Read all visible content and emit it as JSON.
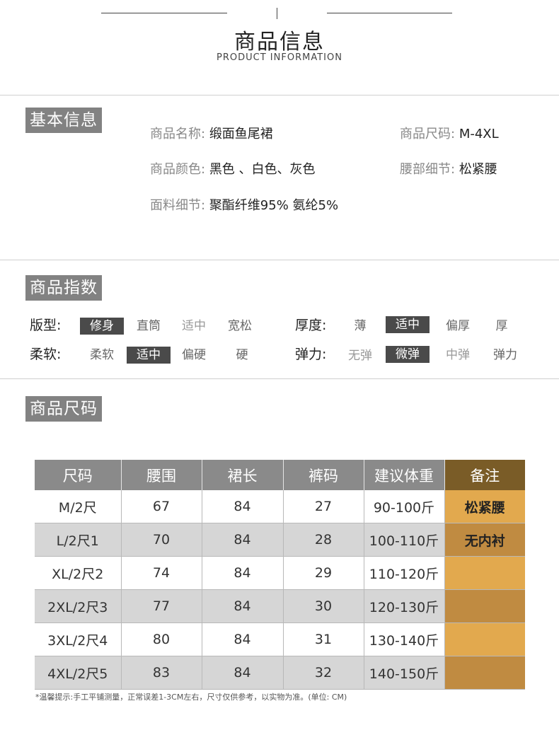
{
  "header": {
    "title_cn": "商品信息",
    "title_en": "PRODUCT INFORMATION"
  },
  "basic": {
    "label": "基本信息",
    "items": [
      {
        "key": "商品名称:",
        "value": "缎面鱼尾裙"
      },
      {
        "key": "商品尺码:",
        "value": "M-4XL"
      },
      {
        "key": "商品颜色:",
        "value": "黑色 、白色、灰色"
      },
      {
        "key": "腰部细节:",
        "value": "松紧腰"
      },
      {
        "key": "面料细节:",
        "value": "聚酯纤维95% 氨纶5%"
      }
    ]
  },
  "index": {
    "label": "商品指数",
    "rows": [
      {
        "key": "版型:",
        "options": [
          "修身",
          "直筒",
          "适中",
          "宽松"
        ],
        "selected": "修身"
      },
      {
        "key": "厚度:",
        "options": [
          "薄",
          "适中",
          "偏厚",
          "厚"
        ],
        "selected": "适中"
      },
      {
        "key": "柔软:",
        "options": [
          "柔软",
          "适中",
          "偏硬",
          "硬"
        ],
        "selected": "适中"
      },
      {
        "key": "弹力:",
        "options": [
          "无弹",
          "微弹",
          "中弹",
          "弹力"
        ],
        "selected": "微弹"
      }
    ]
  },
  "size": {
    "label": "商品尺码",
    "headers": [
      "尺码",
      "腰围",
      "裙长",
      "裤码",
      "建议体重",
      "备注"
    ],
    "rows": [
      [
        "M/2尺",
        "67",
        "84",
        "27",
        "90-100斤",
        "松紧腰"
      ],
      [
        "L/2尺1",
        "70",
        "84",
        "28",
        "100-110斤",
        "无内衬"
      ],
      [
        "XL/2尺2",
        "74",
        "84",
        "29",
        "110-120斤",
        ""
      ],
      [
        "2XL/2尺3",
        "77",
        "84",
        "30",
        "120-130斤",
        ""
      ],
      [
        "3XL/2尺4",
        "80",
        "84",
        "31",
        "130-140斤",
        ""
      ],
      [
        "4XL/2尺5",
        "83",
        "84",
        "32",
        "140-150斤",
        ""
      ]
    ],
    "note": "*温馨提示:手工平铺测量，正常误差1-3CM左右，尺寸仅供参考，以实物为准。(单位: CM)"
  }
}
